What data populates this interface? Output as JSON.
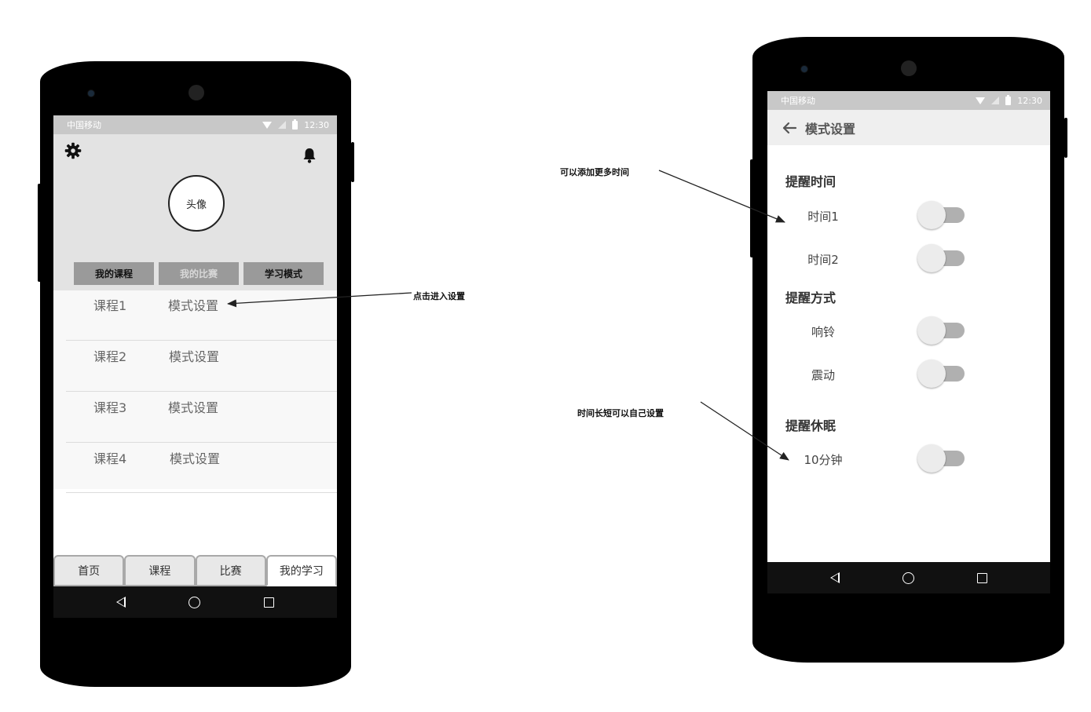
{
  "left_phone": {
    "status": {
      "carrier": "中国移动",
      "time": "12:30"
    },
    "header": {
      "settings_icon": "gear-icon",
      "notify_icon": "bell-icon",
      "avatar_label": "头像",
      "tabs": [
        "我的课程",
        "我的比赛",
        "学习模式"
      ]
    },
    "courses": [
      {
        "name": "课程1",
        "mode": "模式设置"
      },
      {
        "name": "课程2",
        "mode": "模式设置"
      },
      {
        "name": "课程3",
        "mode": "模式设置"
      },
      {
        "name": "课程4",
        "mode": "模式设置"
      }
    ],
    "bottom_tabs": [
      "首页",
      "课程",
      "比赛",
      "我的学习"
    ],
    "selected_bottom_tab": "我的学习"
  },
  "right_phone": {
    "status": {
      "carrier": "中国移动",
      "time": "12:30"
    },
    "app_bar": {
      "back_icon": "arrow-left-icon",
      "title": "模式设置"
    },
    "sections": [
      {
        "title": "提醒时间",
        "items": [
          {
            "label": "时间1",
            "on": false
          },
          {
            "label": "时间2",
            "on": false
          }
        ]
      },
      {
        "title": "提醒方式",
        "items": [
          {
            "label": "响铃",
            "on": false
          },
          {
            "label": "震动",
            "on": false
          }
        ]
      },
      {
        "title": "提醒休眠",
        "items": [
          {
            "label": "10分钟",
            "on": false
          }
        ]
      }
    ]
  },
  "annotations": {
    "enter_settings": "点击进入设置",
    "add_more_times": "可以添加更多时间",
    "duration_custom": "时间长短可以自己设置"
  },
  "colors": {
    "status_bar": "#c8c8c8",
    "header_bg": "#e3e3e3",
    "segment_tab": "#9a9a9a",
    "toggle_track": "#b0b0b0",
    "nav_bar": "#111111"
  }
}
